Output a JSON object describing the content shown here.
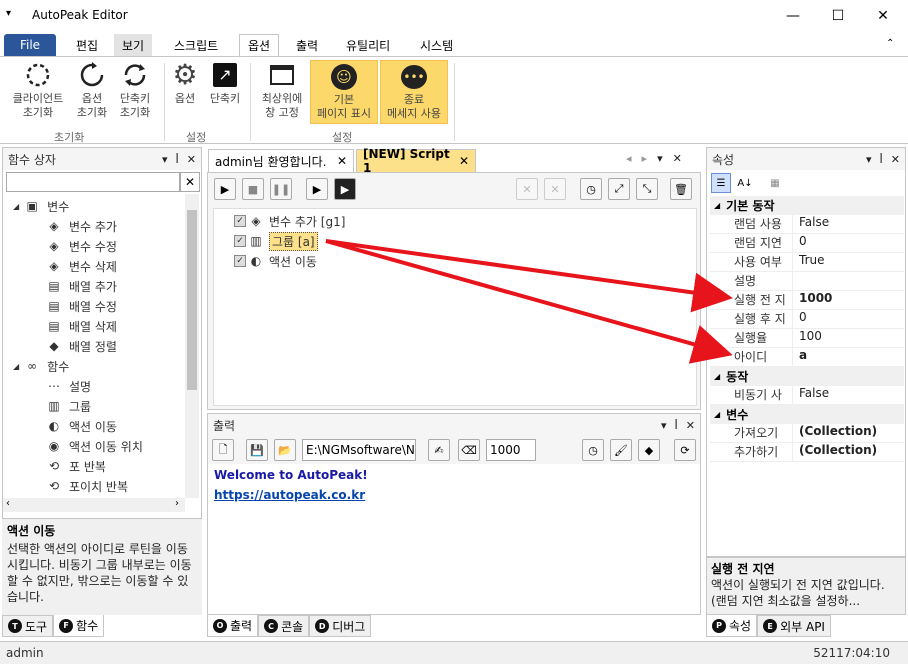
{
  "window": {
    "title": "AutoPeak Editor",
    "min": "—",
    "max": "☐",
    "close": "✕"
  },
  "ribbon_tabs": [
    "File",
    "편집",
    "보기",
    "스크립트",
    "옵션",
    "출력",
    "유틸리티",
    "시스템"
  ],
  "ribbon": {
    "buttons": [
      {
        "label1": "클라이언트",
        "label2": "초기화"
      },
      {
        "label1": "옵션",
        "label2": "초기화"
      },
      {
        "label1": "단축키",
        "label2": "초기화"
      },
      {
        "label1": "옵션",
        "label2": ""
      },
      {
        "label1": "단축키",
        "label2": ""
      },
      {
        "label1": "최상위에",
        "label2": "창 고정"
      },
      {
        "label1": "기본",
        "label2": "페이지 표시"
      },
      {
        "label1": "종료",
        "label2": "메세지 사용"
      }
    ],
    "groups": [
      "초기화",
      "설정",
      "설정"
    ]
  },
  "left_panel": {
    "title": "함수 상자",
    "items": [
      {
        "label": "변수",
        "indent": 0,
        "icon": "▣"
      },
      {
        "label": "변수 추가",
        "indent": 1,
        "icon": "◈"
      },
      {
        "label": "변수 수정",
        "indent": 1,
        "icon": "◈"
      },
      {
        "label": "변수 삭제",
        "indent": 1,
        "icon": "◈"
      },
      {
        "label": "배열 추가",
        "indent": 1,
        "icon": "▤"
      },
      {
        "label": "배열 수정",
        "indent": 1,
        "icon": "▤"
      },
      {
        "label": "배열 삭제",
        "indent": 1,
        "icon": "▤"
      },
      {
        "label": "배열 정렬",
        "indent": 1,
        "icon": "◆"
      },
      {
        "label": "함수",
        "indent": 0,
        "icon": "∞"
      },
      {
        "label": "설명",
        "indent": 1,
        "icon": "⋯"
      },
      {
        "label": "그룹",
        "indent": 1,
        "icon": "▥"
      },
      {
        "label": "액션 이동",
        "indent": 1,
        "icon": "◐"
      },
      {
        "label": "액션 이동 위치",
        "indent": 1,
        "icon": "◉"
      },
      {
        "label": "포 반복",
        "indent": 1,
        "icon": "⟲"
      },
      {
        "label": "포이치 반복",
        "indent": 1,
        "icon": "⟲"
      }
    ],
    "desc_title": "액션 이동",
    "desc_text": "선택한 액션의 아이디로 루틴을 이동시킵니다. 비동기 그룹 내부로는 이동할 수 없지만, 밖으로는 이동할 수 있습니다.",
    "tabs": [
      {
        "letter": "T",
        "label": "도구"
      },
      {
        "letter": "F",
        "label": "함수"
      }
    ]
  },
  "doc_tabs": [
    "admin님 환영합니다.",
    "[NEW] Script 1"
  ],
  "script_tree": [
    {
      "label": "변수 추가 [g1]",
      "icon": "◈"
    },
    {
      "label": "그룹 [a]",
      "icon": "▥"
    },
    {
      "label": "액션 이동",
      "icon": "◐"
    }
  ],
  "output": {
    "title": "출력",
    "path": "E:\\NGMsoftware\\NG",
    "delay": "1000",
    "welcome": "Welcome to AutoPeak!",
    "link": "https://autopeak.co.kr",
    "tabs": [
      {
        "letter": "O",
        "label": "출력"
      },
      {
        "letter": "C",
        "label": "콘솔"
      },
      {
        "letter": "D",
        "label": "디버그"
      }
    ]
  },
  "properties": {
    "title": "속성",
    "cat1": "기본 동작",
    "rows1": [
      {
        "k": "랜덤 사용",
        "v": "False",
        "b": false
      },
      {
        "k": "랜덤 지연",
        "v": "0",
        "b": false
      },
      {
        "k": "사용 여부",
        "v": "True",
        "b": false
      },
      {
        "k": "설명",
        "v": "",
        "b": false
      },
      {
        "k": "실행 전 지",
        "v": "1000",
        "b": true
      },
      {
        "k": "실행 후 지",
        "v": "0",
        "b": false
      },
      {
        "k": "실행율",
        "v": "100",
        "b": false
      },
      {
        "k": "아이디",
        "v": "a",
        "b": true
      }
    ],
    "cat2": "동작",
    "rows2": [
      {
        "k": "비동기 사",
        "v": "False",
        "b": false
      }
    ],
    "cat3": "변수",
    "rows3": [
      {
        "k": "가져오기",
        "v": "(Collection)",
        "b": true
      },
      {
        "k": "추가하기",
        "v": "(Collection)",
        "b": true
      }
    ],
    "desc_title": "실행 전 지연",
    "desc_text": "액션이 실행되기 전 지연 값입니다. (랜덤 지연 최소값을 설정하...",
    "tabs": [
      {
        "letter": "P",
        "label": "속성"
      },
      {
        "letter": "E",
        "label": "외부 API"
      }
    ]
  },
  "status": {
    "user": "admin",
    "time": "52117:04:10"
  },
  "colors": {
    "file_tab": "#2b579a",
    "gold": "#fcd86a",
    "arrow": "#e8141b",
    "doc_tab_active": "#fce08a",
    "link": "#0645ad",
    "welcome": "#1a1aa6"
  }
}
